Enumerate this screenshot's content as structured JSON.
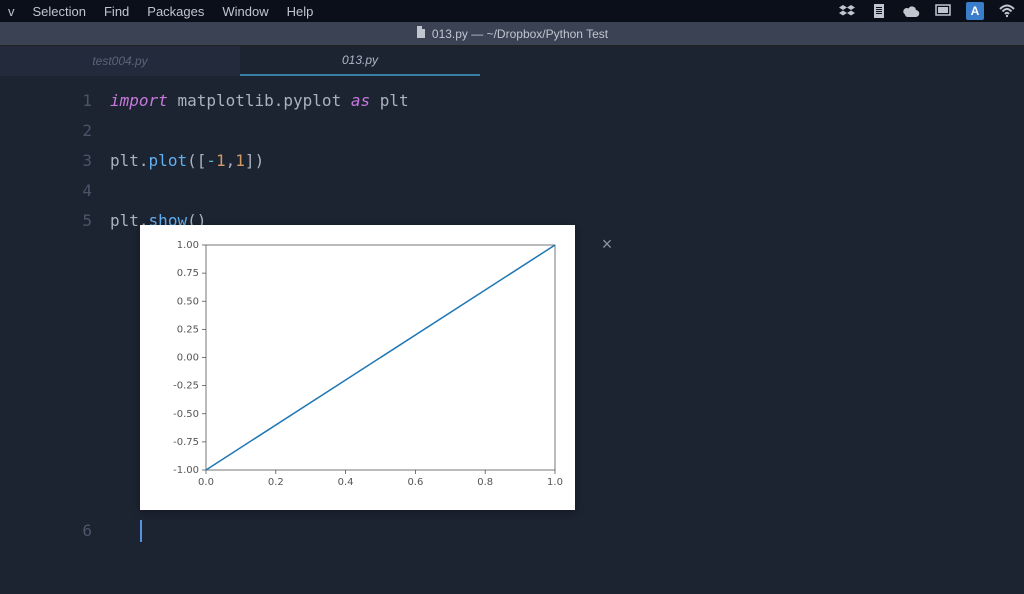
{
  "menubar": {
    "items": [
      "v",
      "Selection",
      "Find",
      "Packages",
      "Window",
      "Help"
    ],
    "sysicons": [
      "dropbox-icon",
      "clipboard-icon",
      "cloud-icon",
      "screen-icon",
      "a-indicator-icon",
      "wifi-icon"
    ]
  },
  "titlebar": {
    "text": "013.py — ~/Dropbox/Python Test"
  },
  "tabs": [
    {
      "label": "test004.py",
      "active": false
    },
    {
      "label": "013.py",
      "active": true
    }
  ],
  "code_lines": [
    {
      "n": 1,
      "tokens": [
        {
          "t": "import",
          "c": "keyword"
        },
        {
          "t": " "
        },
        {
          "t": "matplotlib.pyplot",
          "c": "module"
        },
        {
          "t": " "
        },
        {
          "t": "as",
          "c": "as"
        },
        {
          "t": " "
        },
        {
          "t": "plt",
          "c": "alias"
        }
      ]
    },
    {
      "n": 2,
      "tokens": []
    },
    {
      "n": 3,
      "tokens": [
        {
          "t": "plt",
          "c": "obj"
        },
        {
          "t": ".",
          "c": "dot"
        },
        {
          "t": "plot",
          "c": "func"
        },
        {
          "t": "(",
          "c": "paren"
        },
        {
          "t": "[",
          "c": "bracket"
        },
        {
          "t": "-",
          "c": "op"
        },
        {
          "t": "1",
          "c": "num"
        },
        {
          "t": ",",
          "c": "paren"
        },
        {
          "t": "1",
          "c": "num"
        },
        {
          "t": "]",
          "c": "bracket"
        },
        {
          "t": ")",
          "c": "paren"
        }
      ]
    },
    {
      "n": 4,
      "tokens": []
    },
    {
      "n": 5,
      "tokens": [
        {
          "t": "plt",
          "c": "obj"
        },
        {
          "t": ".",
          "c": "dot"
        },
        {
          "t": "show",
          "c": "func"
        },
        {
          "t": "(",
          "c": "paren"
        },
        {
          "t": ")",
          "c": "paren"
        }
      ]
    }
  ],
  "code_line_after_plot": {
    "n": 6
  },
  "chart_data": {
    "type": "line",
    "x": [
      0,
      1
    ],
    "series": [
      {
        "name": "",
        "values": [
          -1,
          1
        ]
      }
    ],
    "title": "",
    "xlabel": "",
    "ylabel": "",
    "xlim": [
      0.0,
      1.0
    ],
    "ylim": [
      -1.0,
      1.0
    ],
    "xticks": [
      0.0,
      0.2,
      0.4,
      0.6,
      0.8,
      1.0
    ],
    "yticks": [
      -1.0,
      -0.75,
      -0.5,
      -0.25,
      0.0,
      0.25,
      0.5,
      0.75,
      1.0
    ],
    "xtick_labels": [
      "0.0",
      "0.2",
      "0.4",
      "0.6",
      "0.8",
      "1.0"
    ],
    "ytick_labels": [
      "-1.00",
      "-0.75",
      "-0.50",
      "-0.25",
      "0.00",
      "0.25",
      "0.50",
      "0.75",
      "1.00"
    ],
    "color": "#1f77b4"
  },
  "close_label": "×"
}
